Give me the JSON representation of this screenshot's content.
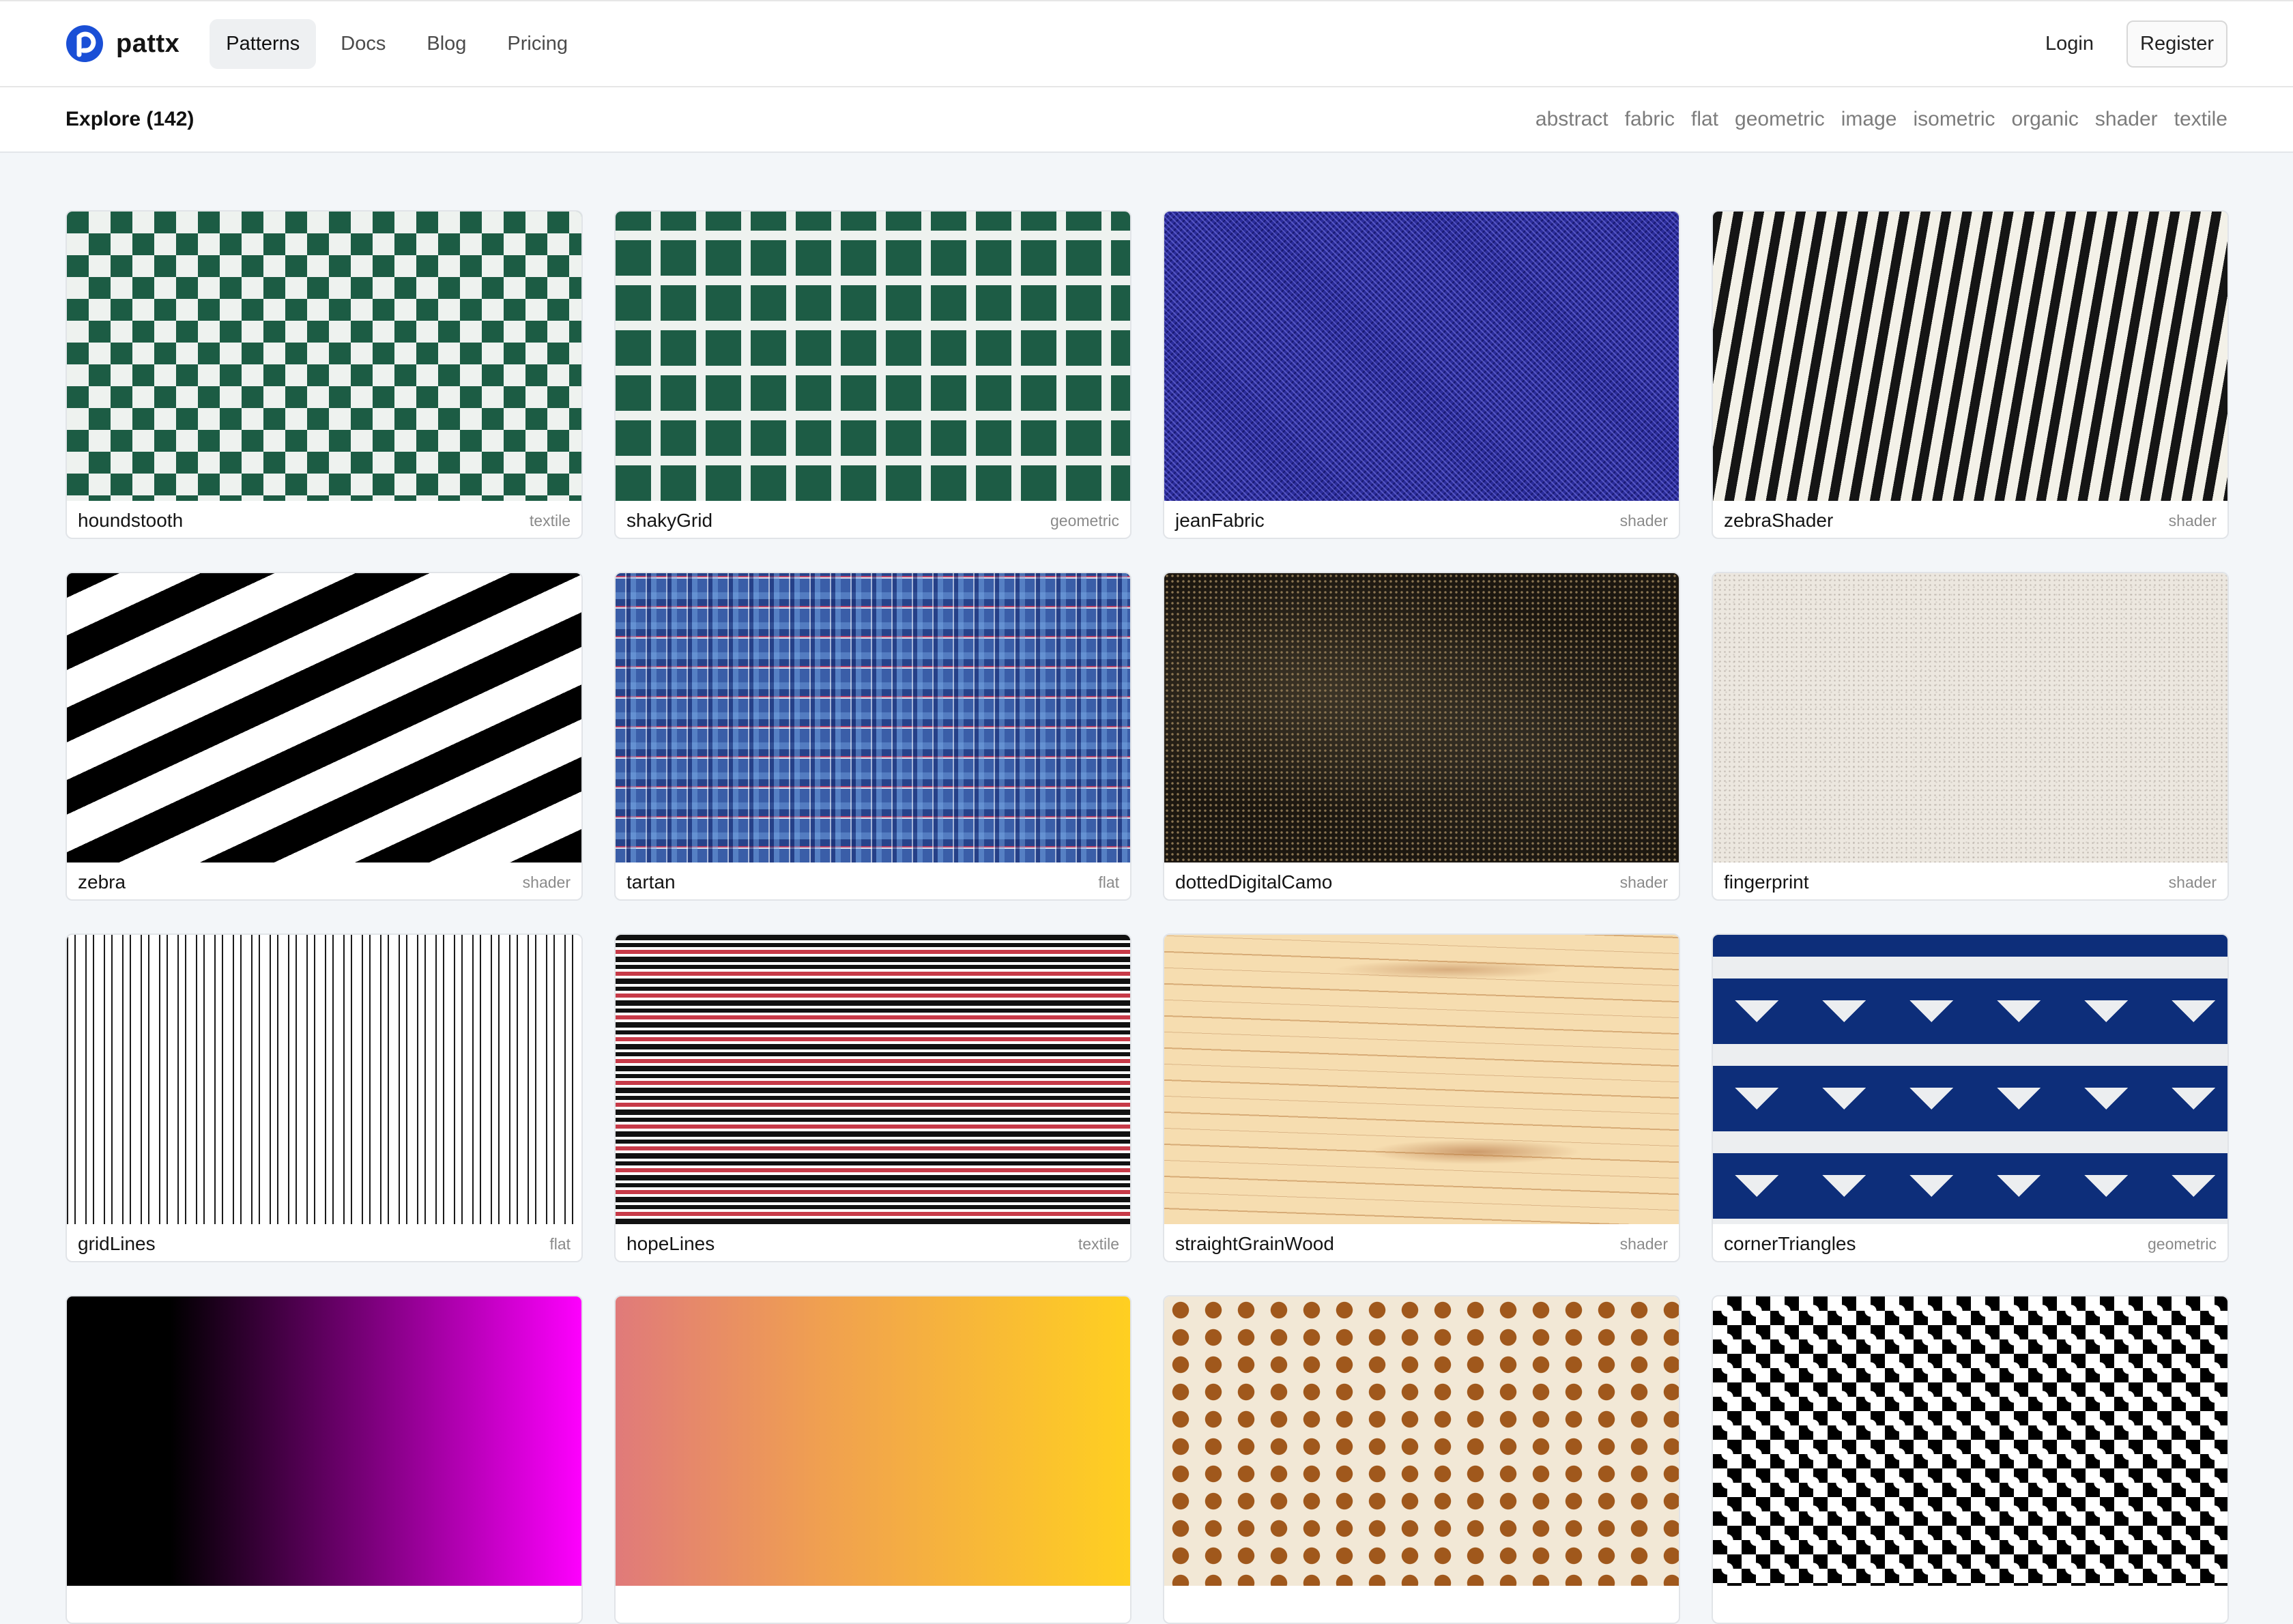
{
  "brand": {
    "name": "pattx",
    "color": "#1a4fd6"
  },
  "nav": {
    "links": [
      {
        "label": "Patterns",
        "active": true
      },
      {
        "label": "Docs",
        "active": false
      },
      {
        "label": "Blog",
        "active": false
      },
      {
        "label": "Pricing",
        "active": false
      }
    ],
    "login_label": "Login",
    "register_label": "Register"
  },
  "explore": {
    "title": "Explore (142)",
    "categories": [
      "abstract",
      "fabric",
      "flat",
      "geometric",
      "image",
      "isometric",
      "organic",
      "shader",
      "textile"
    ]
  },
  "patterns": [
    {
      "name": "houndstooth",
      "tag": "textile",
      "style": "p-houndstooth"
    },
    {
      "name": "shakyGrid",
      "tag": "geometric",
      "style": "p-shakygrid"
    },
    {
      "name": "jeanFabric",
      "tag": "shader",
      "style": "p-jean"
    },
    {
      "name": "zebraShader",
      "tag": "shader",
      "style": "p-zebrashader"
    },
    {
      "name": "zebra",
      "tag": "shader",
      "style": "p-zebra"
    },
    {
      "name": "tartan",
      "tag": "flat",
      "style": "p-tartan"
    },
    {
      "name": "dottedDigitalCamo",
      "tag": "shader",
      "style": "p-camo"
    },
    {
      "name": "fingerprint",
      "tag": "shader",
      "style": "p-fingerprint"
    },
    {
      "name": "gridLines",
      "tag": "flat",
      "style": "p-gridlines"
    },
    {
      "name": "hopeLines",
      "tag": "textile",
      "style": "p-hopelines"
    },
    {
      "name": "straightGrainWood",
      "tag": "shader",
      "style": "p-wood"
    },
    {
      "name": "cornerTriangles",
      "tag": "geometric",
      "style": "p-corner"
    },
    {
      "name": "",
      "tag": "",
      "style": "p-magenta"
    },
    {
      "name": "",
      "tag": "",
      "style": "p-sunset"
    },
    {
      "name": "",
      "tag": "",
      "style": "p-giraffe"
    },
    {
      "name": "",
      "tag": "",
      "style": "p-geo"
    }
  ]
}
